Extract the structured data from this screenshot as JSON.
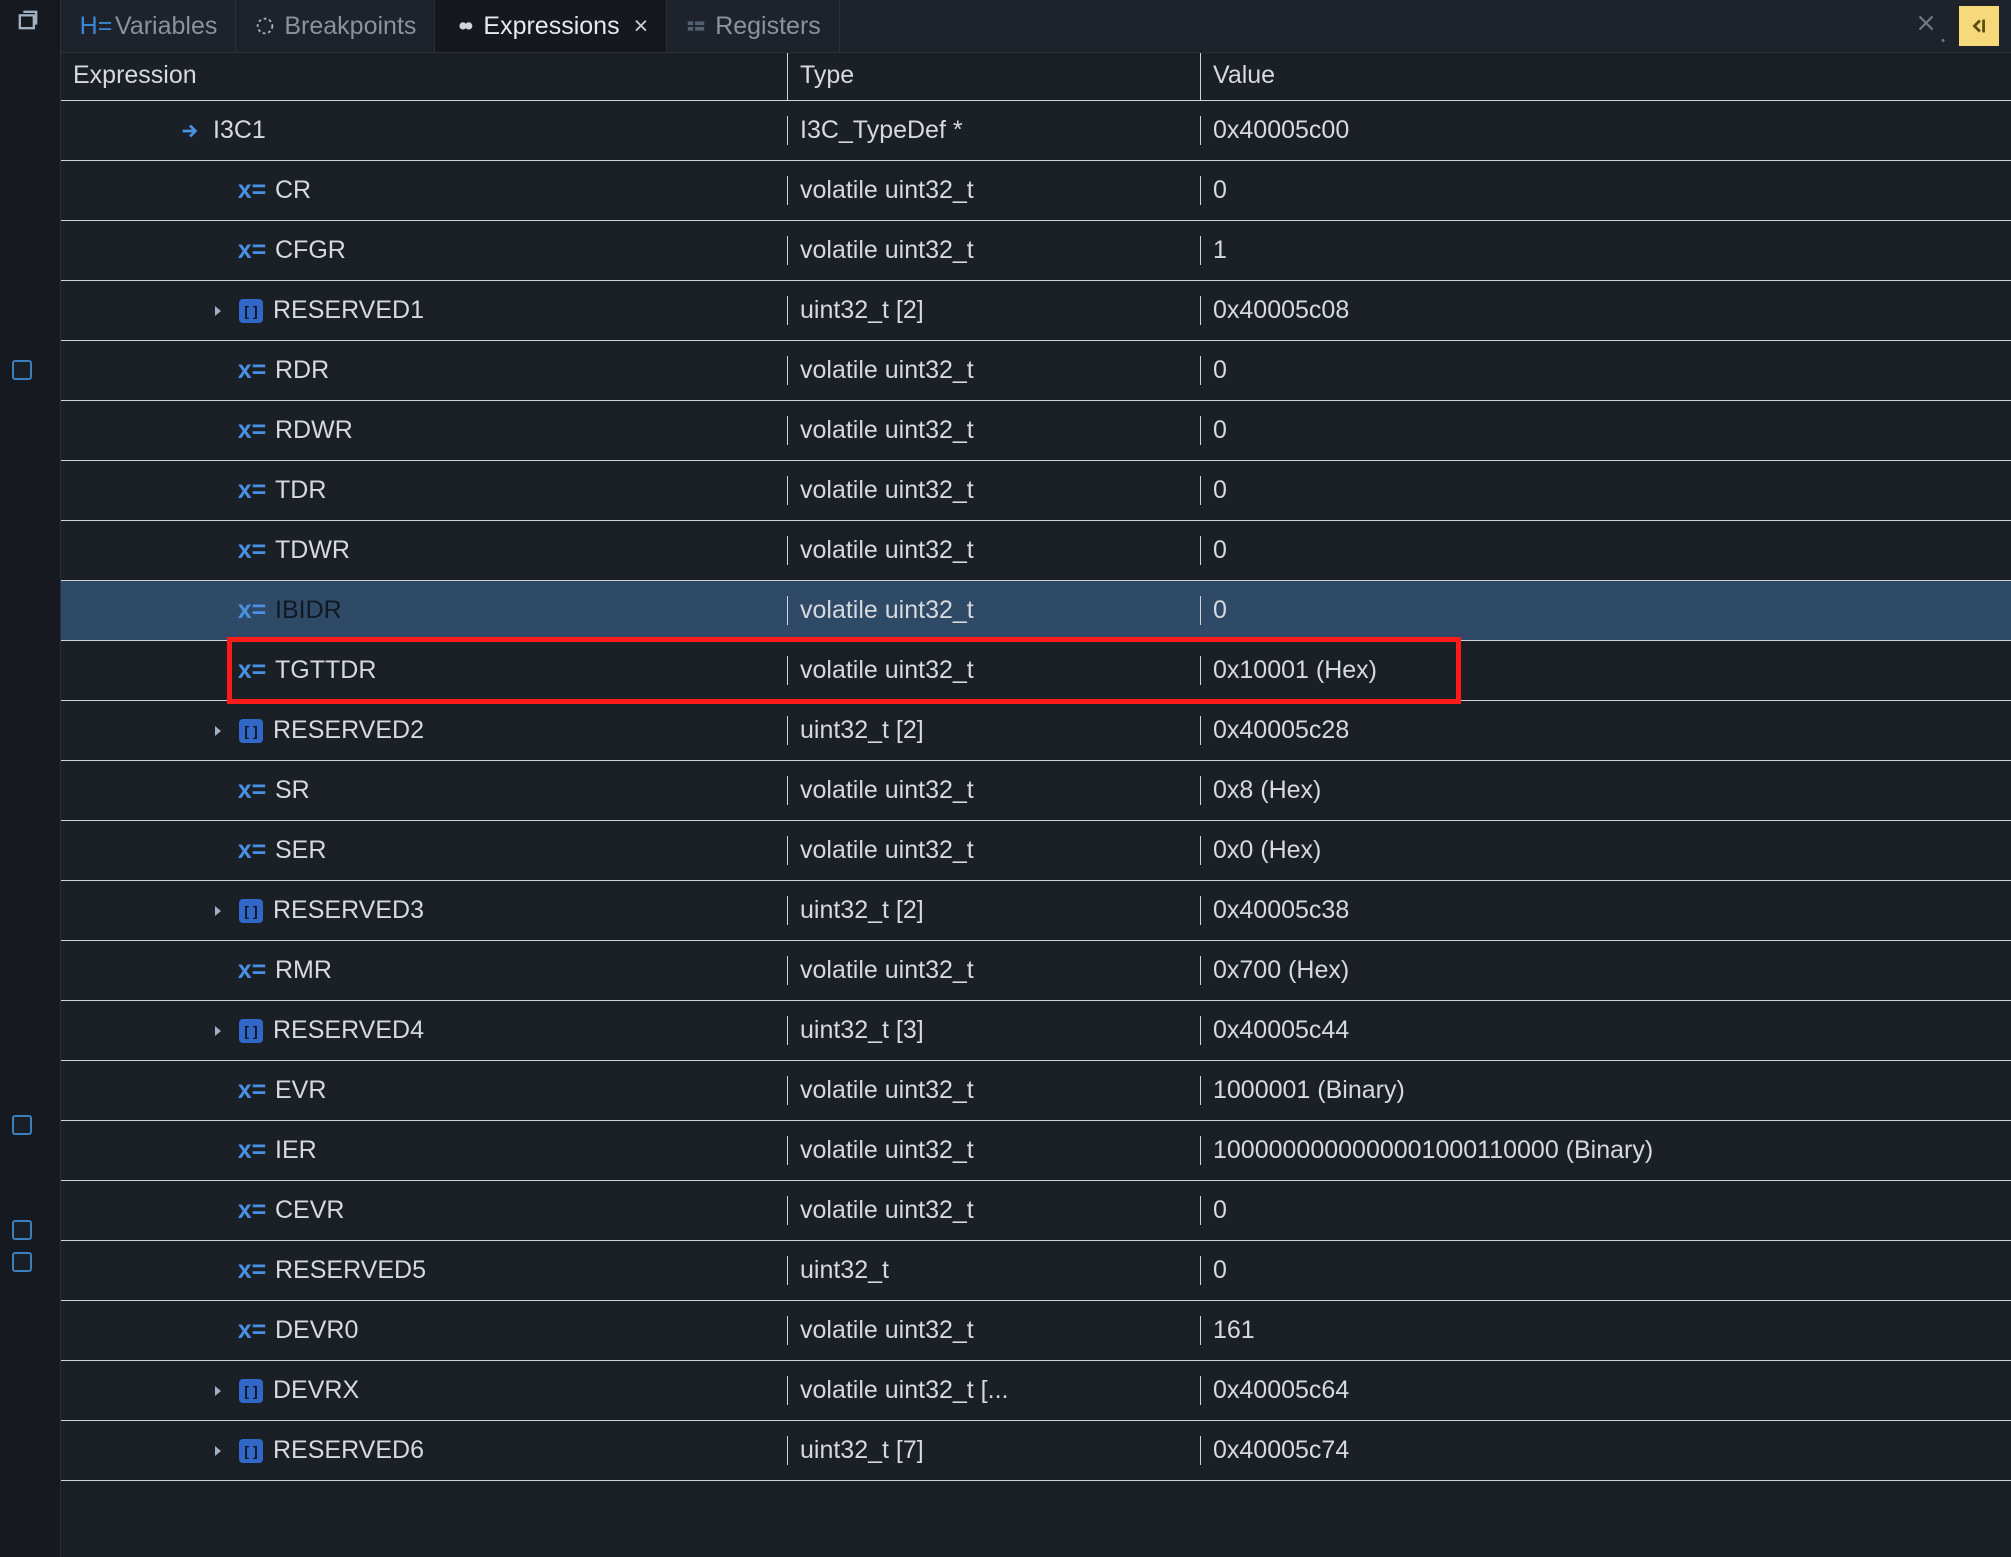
{
  "tabs": {
    "variables": "Variables",
    "breakpoints": "Breakpoints",
    "expressions": "Expressions",
    "registers": "Registers"
  },
  "columns": {
    "expression": "Expression",
    "type": "Type",
    "value": "Value"
  },
  "rows": [
    {
      "indent": 1,
      "twisty": "",
      "kind": "arrow",
      "name": "I3C1",
      "type": "I3C_TypeDef *",
      "value": "0x40005c00"
    },
    {
      "indent": 2,
      "twisty": "",
      "kind": "xeq",
      "name": "CR",
      "type": "volatile uint32_t",
      "value": "0"
    },
    {
      "indent": 2,
      "twisty": "",
      "kind": "xeq",
      "name": "CFGR",
      "type": "volatile uint32_t",
      "value": "1"
    },
    {
      "indent": 2,
      "twisty": ">",
      "kind": "box",
      "name": "RESERVED1",
      "type": "uint32_t [2]",
      "value": "0x40005c08"
    },
    {
      "indent": 2,
      "twisty": "",
      "kind": "xeq",
      "name": "RDR",
      "type": "volatile uint32_t",
      "value": "0"
    },
    {
      "indent": 2,
      "twisty": "",
      "kind": "xeq",
      "name": "RDWR",
      "type": "volatile uint32_t",
      "value": "0"
    },
    {
      "indent": 2,
      "twisty": "",
      "kind": "xeq",
      "name": "TDR",
      "type": "volatile uint32_t",
      "value": "0"
    },
    {
      "indent": 2,
      "twisty": "",
      "kind": "xeq",
      "name": "TDWR",
      "type": "volatile uint32_t",
      "value": "0"
    },
    {
      "indent": 2,
      "twisty": "",
      "kind": "xeq",
      "name": "IBIDR",
      "dim": true,
      "selected": true,
      "type": "volatile uint32_t",
      "value": "0"
    },
    {
      "indent": 2,
      "twisty": "",
      "kind": "xeq",
      "name": "TGTTDR",
      "hl": true,
      "type": "volatile uint32_t",
      "value": "0x10001 (Hex)"
    },
    {
      "indent": 2,
      "twisty": ">",
      "kind": "box",
      "name": "RESERVED2",
      "type": "uint32_t [2]",
      "value": "0x40005c28"
    },
    {
      "indent": 2,
      "twisty": "",
      "kind": "xeq",
      "name": "SR",
      "type": "volatile uint32_t",
      "value": "0x8 (Hex)"
    },
    {
      "indent": 2,
      "twisty": "",
      "kind": "xeq",
      "name": "SER",
      "type": "volatile uint32_t",
      "value": "0x0 (Hex)"
    },
    {
      "indent": 2,
      "twisty": ">",
      "kind": "box",
      "name": "RESERVED3",
      "type": "uint32_t [2]",
      "value": "0x40005c38"
    },
    {
      "indent": 2,
      "twisty": "",
      "kind": "xeq",
      "name": "RMR",
      "type": "volatile uint32_t",
      "value": "0x700 (Hex)"
    },
    {
      "indent": 2,
      "twisty": ">",
      "kind": "box",
      "name": "RESERVED4",
      "type": "uint32_t [3]",
      "value": "0x40005c44"
    },
    {
      "indent": 2,
      "twisty": "",
      "kind": "xeq",
      "name": "EVR",
      "type": "volatile uint32_t",
      "value": "1000001 (Binary)"
    },
    {
      "indent": 2,
      "twisty": "",
      "kind": "xeq",
      "name": "IER",
      "type": "volatile uint32_t",
      "value": "1000000000000001000110000 (Binary)"
    },
    {
      "indent": 2,
      "twisty": "",
      "kind": "xeq",
      "name": "CEVR",
      "type": "volatile uint32_t",
      "value": "0"
    },
    {
      "indent": 2,
      "twisty": "",
      "kind": "xeq",
      "name": "RESERVED5",
      "type": "uint32_t",
      "value": "0"
    },
    {
      "indent": 2,
      "twisty": "",
      "kind": "xeq",
      "name": "DEVR0",
      "type": "volatile uint32_t",
      "value": "161"
    },
    {
      "indent": 2,
      "twisty": ">",
      "kind": "box",
      "name": "DEVRX",
      "type": "volatile uint32_t [...",
      "value": "0x40005c64"
    },
    {
      "indent": 2,
      "twisty": ">",
      "kind": "box",
      "name": "RESERVED6",
      "type": "uint32_t [7]",
      "value": "0x40005c74"
    }
  ],
  "icon_xeq_text": "x=",
  "icon_box_text": "[ ]"
}
